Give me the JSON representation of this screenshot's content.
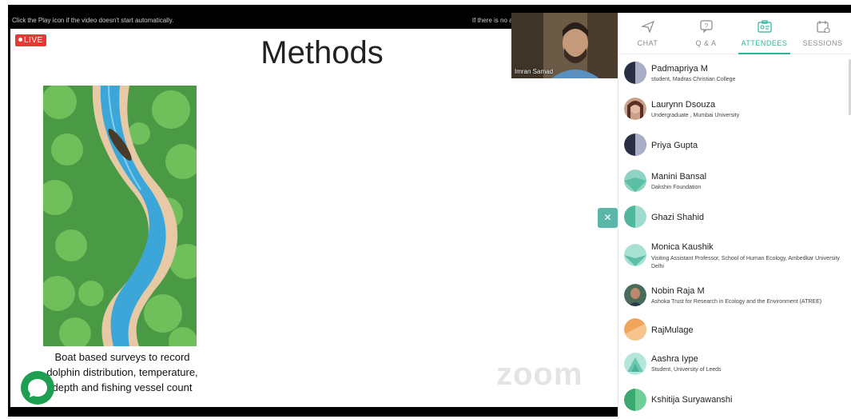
{
  "video": {
    "notice_left": "Click the Play icon if the video doesn't start automatically.",
    "notice_right": "If there is no audio, use the Volume icon to unmute",
    "live_label": "LIVE",
    "speaker_name": "Imran Samad",
    "watermark": "zoom"
  },
  "slide": {
    "title": "Methods",
    "caption_lines": [
      "Boat based surveys to record",
      "dolphin distribution, temperature,",
      "depth and fishing vessel count"
    ]
  },
  "panel": {
    "tabs": [
      {
        "label": "CHAT",
        "icon": "send-icon"
      },
      {
        "label": "Q & A",
        "icon": "question-icon"
      },
      {
        "label": "ATTENDEES",
        "icon": "attendee-card-icon"
      },
      {
        "label": "SESSIONS",
        "icon": "calendar-icon"
      }
    ],
    "active_tab": "ATTENDEES",
    "attendees": [
      {
        "name": "Padmapriya M",
        "subtitle": "student, Madras Christian College",
        "avatar": "split-navy"
      },
      {
        "name": "Laurynn Dsouza",
        "subtitle": "Undergraduate , Mumbai University",
        "avatar": "photo"
      },
      {
        "name": "Priya Gupta",
        "subtitle": "",
        "avatar": "split-navy"
      },
      {
        "name": "Manini Bansal",
        "subtitle": "Dakshin Foundation",
        "avatar": "teal-geo"
      },
      {
        "name": "Ghazi Shahid",
        "subtitle": "",
        "avatar": "teal-split"
      },
      {
        "name": "Monica Kaushik",
        "subtitle": "Visiting Assistant Professor, School of Human Ecology, Ambedkar University Delhi",
        "avatar": "teal-geo"
      },
      {
        "name": "Nobin Raja M",
        "subtitle": "Ashoka Trust for Research in Ecology and the Environment (ATREE)",
        "avatar": "photo-dark"
      },
      {
        "name": "RajMulage",
        "subtitle": "",
        "avatar": "orange-split"
      },
      {
        "name": "Aashra Iype",
        "subtitle": "Student, University of Leeds",
        "avatar": "teal-stripe"
      },
      {
        "name": "Kshitija Suryawanshi",
        "subtitle": "",
        "avatar": "green-split"
      }
    ]
  },
  "colors": {
    "accent": "#2bb59b",
    "live": "#e53935",
    "chat_fab": "#1e9e50"
  }
}
